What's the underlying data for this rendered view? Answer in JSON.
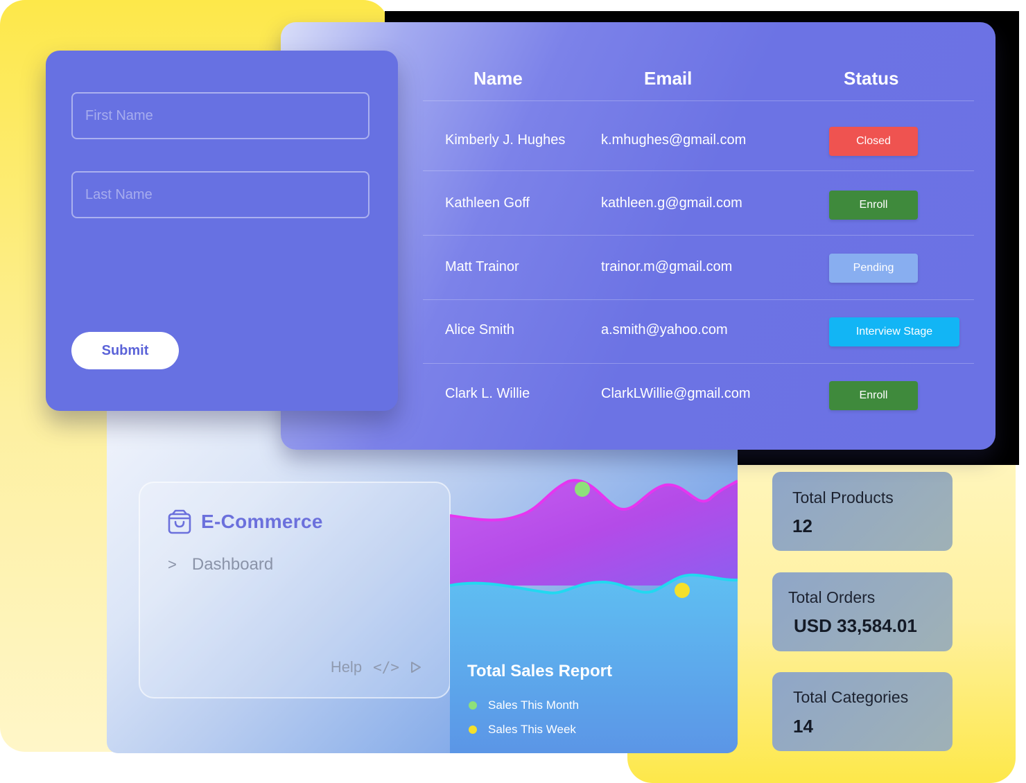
{
  "form": {
    "first_name_placeholder": "First Name",
    "last_name_placeholder": "Last Name",
    "submit_label": "Submit"
  },
  "table": {
    "headers": {
      "name": "Name",
      "email": "Email",
      "status": "Status"
    },
    "rows": [
      {
        "name": "Kimberly J. Hughes",
        "email": "k.mhughes@gmail.com",
        "status": "Closed",
        "status_color": "#ef5350"
      },
      {
        "name": "Kathleen Goff",
        "email": "kathleen.g@gmail.com",
        "status": "Enroll",
        "status_color": "#3f8a3c"
      },
      {
        "name": "Matt Trainor",
        "email": "trainor.m@gmail.com",
        "status": "Pending",
        "status_color": "#88aef0"
      },
      {
        "name": "Alice Smith",
        "email": "a.smith@yahoo.com",
        "status": "Interview Stage",
        "status_color": "#12b5f5"
      },
      {
        "name": "Clark L. Willie",
        "email": "ClarkLWillie@gmail.com",
        "status": "Enroll",
        "status_color": "#3f8a3c"
      }
    ]
  },
  "ecommerce": {
    "title": "E-Commerce",
    "icon": "shopping-bag-icon",
    "breadcrumb_chevron": ">",
    "breadcrumb_label": "Dashboard",
    "help_label": "Help",
    "code_symbol": "</>"
  },
  "report": {
    "title": "Total Sales Report",
    "legend": [
      {
        "label": "Sales This Month",
        "color": "#8ee07a"
      },
      {
        "label": "Sales This Week",
        "color": "#f5e02a"
      }
    ]
  },
  "stats": [
    {
      "label": "Total Products",
      "value": "12"
    },
    {
      "label": "Total Orders",
      "value": "USD 33,584.01"
    },
    {
      "label": "Total Categories",
      "value": "14"
    }
  ],
  "colors": {
    "accent": "#6771e2",
    "magenta_line": "#e635f0",
    "cyan_line": "#22d8f0"
  }
}
